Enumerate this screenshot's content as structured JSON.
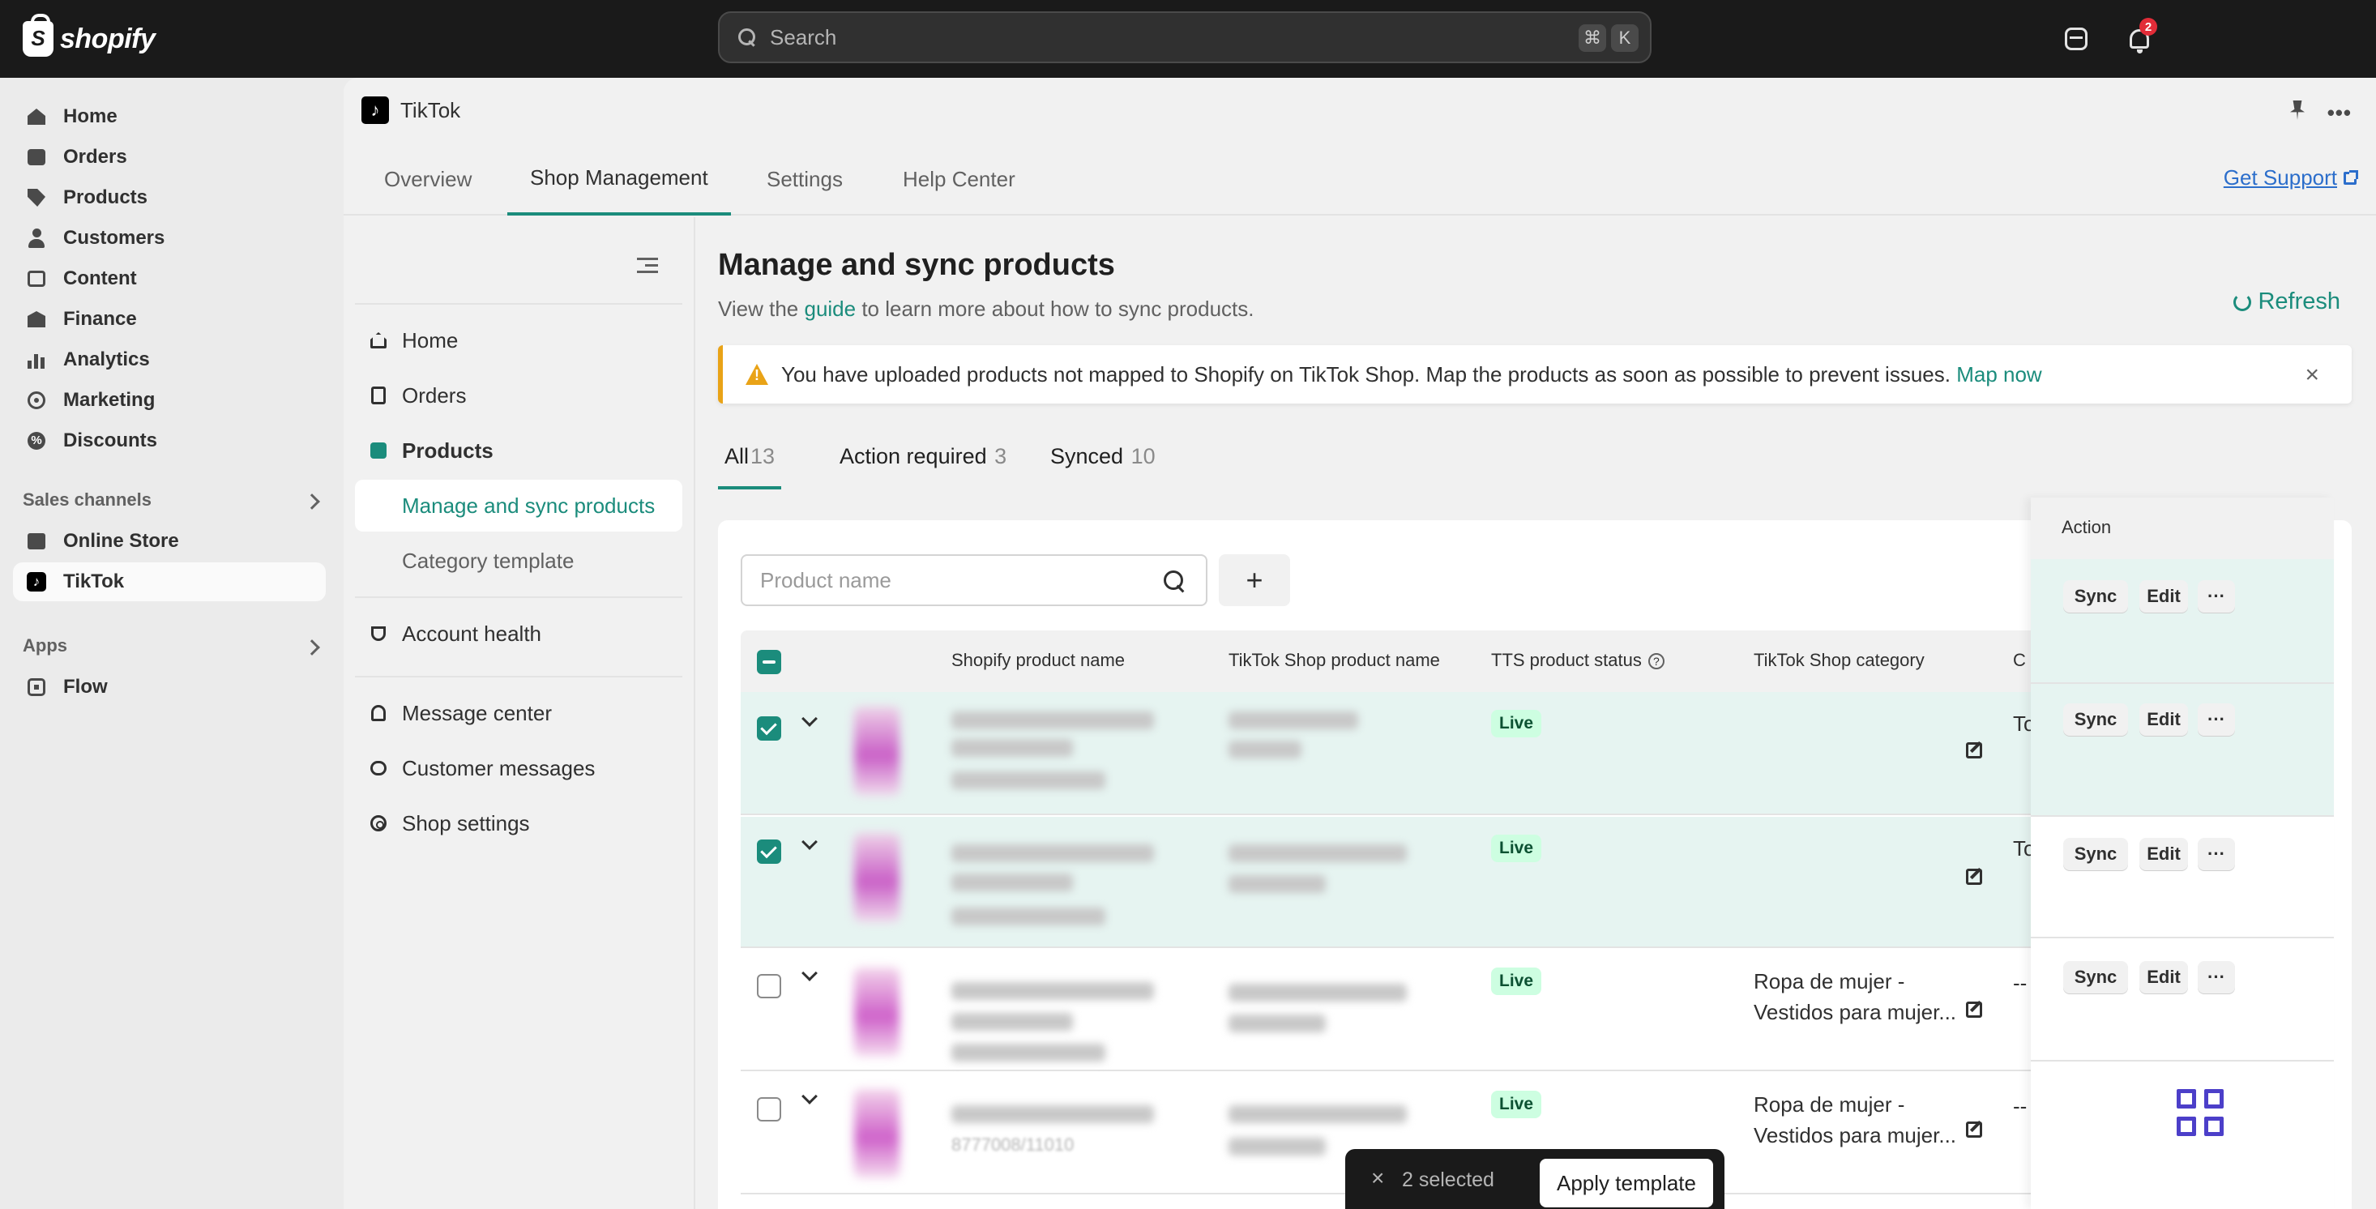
{
  "topbar": {
    "logo_text": "shopify",
    "search_placeholder": "Search",
    "shortcut_cmd": "⌘",
    "shortcut_key": "K",
    "notification_count": "2"
  },
  "sidebar": {
    "items": [
      {
        "label": "Home",
        "icon": "home-icon"
      },
      {
        "label": "Orders",
        "icon": "orders-icon"
      },
      {
        "label": "Products",
        "icon": "tag-icon"
      },
      {
        "label": "Customers",
        "icon": "person-icon"
      },
      {
        "label": "Content",
        "icon": "content-icon"
      },
      {
        "label": "Finance",
        "icon": "bank-icon"
      },
      {
        "label": "Analytics",
        "icon": "chart-icon"
      },
      {
        "label": "Marketing",
        "icon": "target-icon"
      },
      {
        "label": "Discounts",
        "icon": "discount-icon"
      }
    ],
    "sales_channels_label": "Sales channels",
    "channels": [
      {
        "label": "Online Store",
        "icon": "store-icon"
      },
      {
        "label": "TikTok",
        "icon": "tiktok-icon"
      }
    ],
    "apps_label": "Apps",
    "apps": [
      {
        "label": "Flow",
        "icon": "flow-icon"
      }
    ]
  },
  "app": {
    "title": "TikTok",
    "tabs": [
      "Overview",
      "Shop Management",
      "Settings",
      "Help Center"
    ],
    "get_support": "Get Support"
  },
  "inner_nav": {
    "home": "Home",
    "orders": "Orders",
    "products": "Products",
    "manage_sync": "Manage and sync products",
    "category_template": "Category template",
    "account_health": "Account health",
    "message_center": "Message center",
    "customer_messages": "Customer messages",
    "shop_settings": "Shop settings"
  },
  "main": {
    "title": "Manage and sync products",
    "subtitle_pre": "View the ",
    "subtitle_link": "guide",
    "subtitle_post": " to learn more about how to sync products.",
    "refresh": "Refresh",
    "banner_text": "You have uploaded products not mapped to Shopify on TikTok Shop. Map the products as soon as possible to prevent issues.",
    "banner_link": "Map now",
    "filter_tabs": [
      {
        "label": "All",
        "count": "13"
      },
      {
        "label": "Action required",
        "count": "3"
      },
      {
        "label": "Synced",
        "count": "10"
      }
    ],
    "search_placeholder": "Product name",
    "add_button": "+"
  },
  "table": {
    "headers": {
      "shopify_name": "Shopify product name",
      "tiktok_name": "TikTok Shop product name",
      "status": "TTS product status",
      "category": "TikTok Shop category",
      "c": "C",
      "action": "Action"
    },
    "rows": [
      {
        "selected": true,
        "status": "Live",
        "category_line1": "",
        "category_line2": "",
        "c_value": "To",
        "sync": "Sync",
        "edit": "Edit",
        "more": "···"
      },
      {
        "selected": true,
        "status": "Live",
        "category_line1": "",
        "category_line2": "",
        "c_value": "To",
        "sync": "Sync",
        "edit": "Edit",
        "more": "···"
      },
      {
        "selected": false,
        "status": "Live",
        "category_line1": "Ropa de mujer -",
        "category_line2": "Vestidos para mujer...",
        "c_value": "--",
        "sync": "Sync",
        "edit": "Edit",
        "more": "···"
      },
      {
        "selected": false,
        "status": "Live",
        "category_line1": "Ropa de mujer -",
        "category_line2": "Vestidos para mujer...",
        "c_value": "--",
        "sync": "Sync",
        "edit": "Edit",
        "more": "···"
      }
    ],
    "visible_sku_fragment": "8777008/11010"
  },
  "selection_bar": {
    "close": "×",
    "selected_text": "2 selected",
    "apply_button": "Apply template"
  },
  "colors": {
    "accent": "#1b8c7c",
    "topbar": "#1a1a1a",
    "warning": "#e9a317",
    "live_bg": "#cdfee1",
    "link": "#2c6ecb"
  }
}
